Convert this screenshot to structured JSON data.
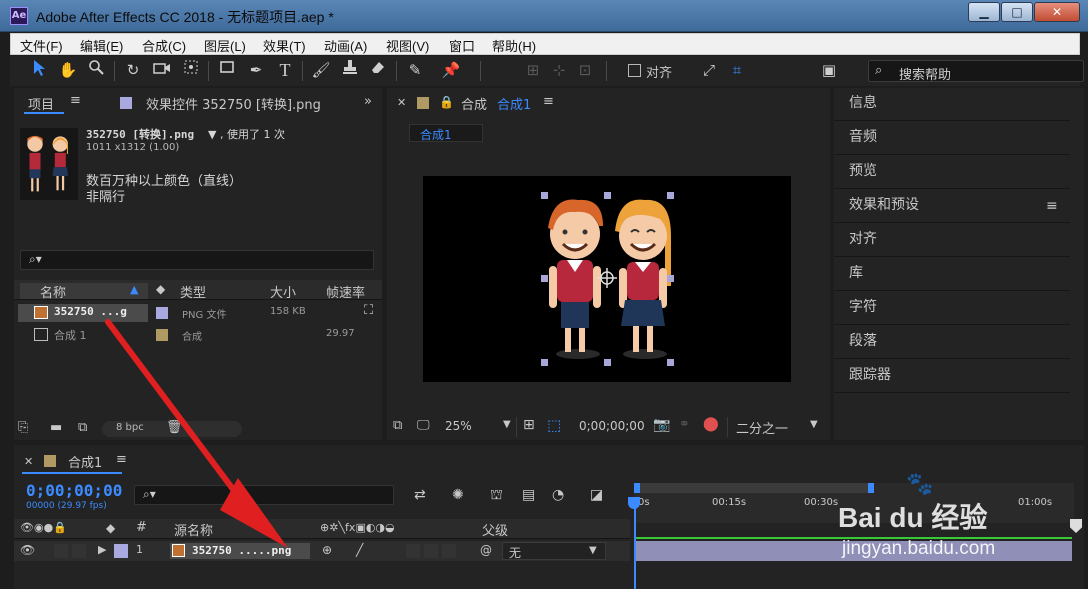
{
  "window": {
    "title": "Adobe After Effects CC 2018 - 无标题项目.aep *",
    "app_icon_text": "Ae",
    "controls": {
      "minimize": "▁",
      "maximize": "□",
      "close": "✕"
    }
  },
  "menu": [
    "文件(F)",
    "编辑(E)",
    "合成(C)",
    "图层(L)",
    "效果(T)",
    "动画(A)",
    "视图(V)",
    "窗口",
    "帮助(H)"
  ],
  "toolbar": {
    "snap_label": "对齐",
    "search_label": "搜索帮助",
    "tools": [
      "selection-tool",
      "hand-tool",
      "zoom-tool",
      "rotate-tool",
      "camera-tool",
      "pan-behind-tool",
      "rectangle-tool",
      "pen-tool",
      "type-tool",
      "brush-tool",
      "clone-stamp-tool",
      "eraser-tool",
      "roto-brush-tool",
      "puppet-pin-tool"
    ]
  },
  "project_panel": {
    "tab_project": "项目",
    "tab_effects": "效果控件 352750 [转换].png",
    "selected_name": "352750 [转换].png",
    "selected_usage": "▼ , 使用了 1 次",
    "selected_size": "1011 x1312 (1.00)",
    "color_info": "数百万种以上颜色（直线）",
    "interlace": "非隔行",
    "columns": {
      "name": "名称",
      "type": "类型",
      "size": "大小",
      "fps": "帧速率"
    },
    "items": [
      {
        "name": "352750 ...g",
        "type": "PNG 文件",
        "size": "158 KB",
        "fps": "",
        "label_color": "#a9a9e0"
      },
      {
        "name": "合成 1",
        "type": "合成",
        "size": "",
        "fps": "29.97",
        "label_color": "#b09a63"
      }
    ],
    "bpc": "8 bpc"
  },
  "viewer": {
    "tab_label": "合成",
    "comp_name": "合成1",
    "breadcrumb": "合成1",
    "zoom": "25%",
    "timecode": "0;00;00;00",
    "resolution": "二分之一"
  },
  "right_panel": [
    "信息",
    "音频",
    "预览",
    "效果和预设",
    "对齐",
    "库",
    "字符",
    "段落",
    "跟踪器"
  ],
  "timeline": {
    "tab_label": "合成1",
    "timecode": "0;00;00;00",
    "frame_info": "00000 (29.97 fps)",
    "ruler": [
      "0s",
      "00:15s",
      "00:30s",
      "01:00s"
    ],
    "columns": {
      "source_name": "源名称",
      "parent": "父级",
      "index": "#"
    },
    "layers": [
      {
        "index": "1",
        "name": "352750 .....png",
        "parent": "无",
        "label_color": "#a9a9e0"
      }
    ]
  },
  "watermark": {
    "brand": "Bai du 经验",
    "url": "jingyan.baidu.com"
  },
  "colors": {
    "accent": "#3b8bff",
    "arrow": "#e02020",
    "timecode": "#3b8bff"
  }
}
